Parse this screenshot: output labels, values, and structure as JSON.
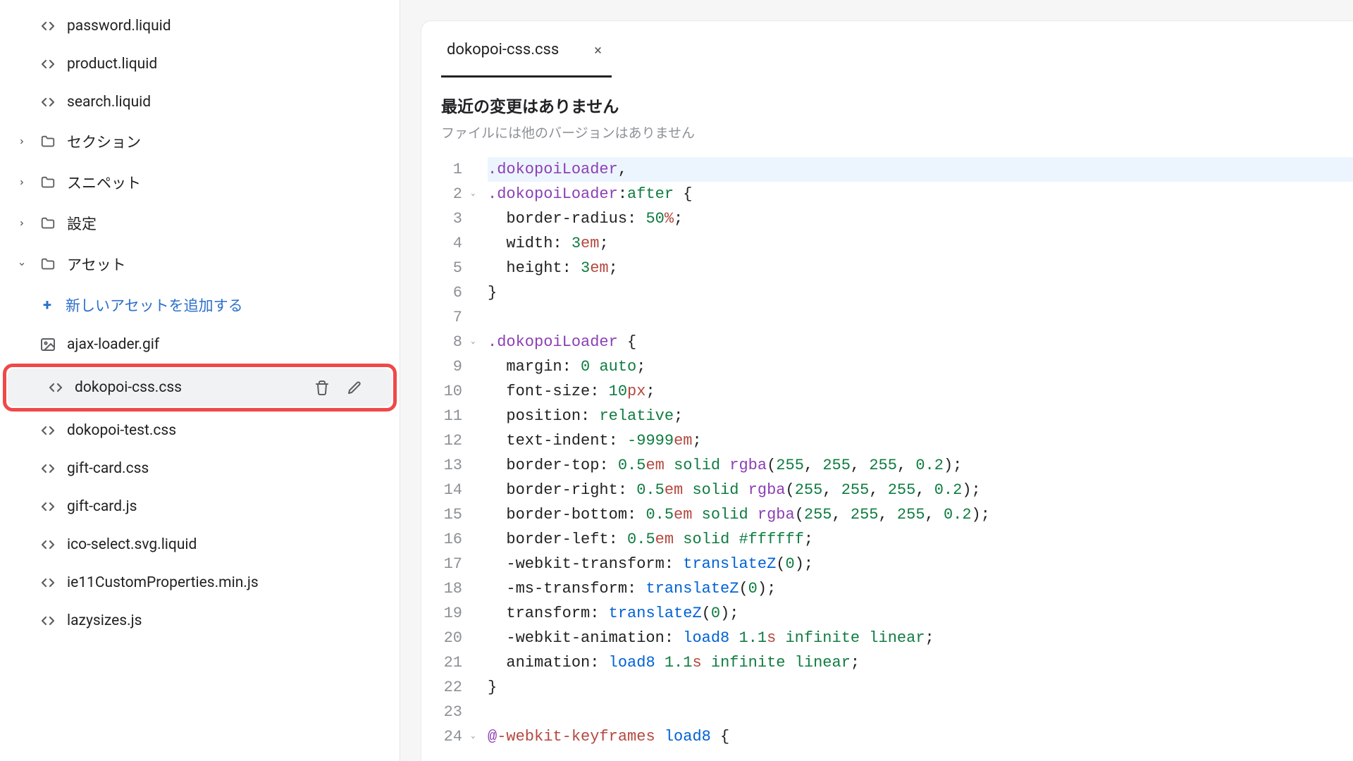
{
  "sidebar": {
    "files_top": [
      {
        "name": "password.liquid",
        "icon": "code"
      },
      {
        "name": "product.liquid",
        "icon": "code"
      },
      {
        "name": "search.liquid",
        "icon": "code"
      }
    ],
    "folders": [
      {
        "name": "セクション",
        "expanded": false
      },
      {
        "name": "スニペット",
        "expanded": false
      },
      {
        "name": "設定",
        "expanded": false
      },
      {
        "name": "アセット",
        "expanded": true
      }
    ],
    "add_asset_label": "新しいアセットを追加する",
    "assets": [
      {
        "name": "ajax-loader.gif",
        "icon": "image"
      },
      {
        "name": "dokopoi-css.css",
        "icon": "code",
        "selected": true,
        "highlight": true
      },
      {
        "name": "dokopoi-test.css",
        "icon": "code"
      },
      {
        "name": "gift-card.css",
        "icon": "code"
      },
      {
        "name": "gift-card.js",
        "icon": "code"
      },
      {
        "name": "ico-select.svg.liquid",
        "icon": "code"
      },
      {
        "name": "ie11CustomProperties.min.js",
        "icon": "code"
      },
      {
        "name": "lazysizes.js",
        "icon": "code"
      }
    ]
  },
  "editor": {
    "tab_name": "dokopoi-css.css",
    "info_title": "最近の変更はありません",
    "info_subtitle": "ファイルには他のバージョンはありません",
    "fold_lines": [
      2,
      8,
      24
    ],
    "current_line": 1,
    "code_lines": [
      [
        {
          "t": "sel",
          "v": ".dokopoiLoader"
        },
        {
          "t": "punct",
          "v": ","
        }
      ],
      [
        {
          "t": "sel",
          "v": ".dokopoiLoader"
        },
        {
          "t": "punct",
          "v": ":"
        },
        {
          "t": "pseudo",
          "v": "after"
        },
        {
          "t": "punct",
          "v": " {"
        }
      ],
      [
        {
          "t": "prop",
          "v": "  border-radius: "
        },
        {
          "t": "num",
          "v": "50"
        },
        {
          "t": "unit",
          "v": "%"
        },
        {
          "t": "punct",
          "v": ";"
        }
      ],
      [
        {
          "t": "prop",
          "v": "  width: "
        },
        {
          "t": "num",
          "v": "3"
        },
        {
          "t": "unit",
          "v": "em"
        },
        {
          "t": "punct",
          "v": ";"
        }
      ],
      [
        {
          "t": "prop",
          "v": "  height: "
        },
        {
          "t": "num",
          "v": "3"
        },
        {
          "t": "unit",
          "v": "em"
        },
        {
          "t": "punct",
          "v": ";"
        }
      ],
      [
        {
          "t": "punct",
          "v": "}"
        }
      ],
      [],
      [
        {
          "t": "sel",
          "v": ".dokopoiLoader"
        },
        {
          "t": "punct",
          "v": " {"
        }
      ],
      [
        {
          "t": "prop",
          "v": "  margin: "
        },
        {
          "t": "num",
          "v": "0 "
        },
        {
          "t": "pseudo",
          "v": "auto"
        },
        {
          "t": "punct",
          "v": ";"
        }
      ],
      [
        {
          "t": "prop",
          "v": "  font-size: "
        },
        {
          "t": "num",
          "v": "10"
        },
        {
          "t": "unit",
          "v": "px"
        },
        {
          "t": "punct",
          "v": ";"
        }
      ],
      [
        {
          "t": "prop",
          "v": "  position: "
        },
        {
          "t": "pseudo",
          "v": "relative"
        },
        {
          "t": "punct",
          "v": ";"
        }
      ],
      [
        {
          "t": "prop",
          "v": "  text-indent: "
        },
        {
          "t": "num",
          "v": "-9999"
        },
        {
          "t": "unit",
          "v": "em"
        },
        {
          "t": "punct",
          "v": ";"
        }
      ],
      [
        {
          "t": "prop",
          "v": "  border-top: "
        },
        {
          "t": "num",
          "v": "0.5"
        },
        {
          "t": "unit",
          "v": "em "
        },
        {
          "t": "pseudo",
          "v": "solid "
        },
        {
          "t": "func",
          "v": "rgba"
        },
        {
          "t": "punct",
          "v": "("
        },
        {
          "t": "num",
          "v": "255"
        },
        {
          "t": "punct",
          "v": ", "
        },
        {
          "t": "num",
          "v": "255"
        },
        {
          "t": "punct",
          "v": ", "
        },
        {
          "t": "num",
          "v": "255"
        },
        {
          "t": "punct",
          "v": ", "
        },
        {
          "t": "num",
          "v": "0.2"
        },
        {
          "t": "punct",
          "v": ");"
        }
      ],
      [
        {
          "t": "prop",
          "v": "  border-right: "
        },
        {
          "t": "num",
          "v": "0.5"
        },
        {
          "t": "unit",
          "v": "em "
        },
        {
          "t": "pseudo",
          "v": "solid "
        },
        {
          "t": "func",
          "v": "rgba"
        },
        {
          "t": "punct",
          "v": "("
        },
        {
          "t": "num",
          "v": "255"
        },
        {
          "t": "punct",
          "v": ", "
        },
        {
          "t": "num",
          "v": "255"
        },
        {
          "t": "punct",
          "v": ", "
        },
        {
          "t": "num",
          "v": "255"
        },
        {
          "t": "punct",
          "v": ", "
        },
        {
          "t": "num",
          "v": "0.2"
        },
        {
          "t": "punct",
          "v": ");"
        }
      ],
      [
        {
          "t": "prop",
          "v": "  border-bottom: "
        },
        {
          "t": "num",
          "v": "0.5"
        },
        {
          "t": "unit",
          "v": "em "
        },
        {
          "t": "pseudo",
          "v": "solid "
        },
        {
          "t": "func",
          "v": "rgba"
        },
        {
          "t": "punct",
          "v": "("
        },
        {
          "t": "num",
          "v": "255"
        },
        {
          "t": "punct",
          "v": ", "
        },
        {
          "t": "num",
          "v": "255"
        },
        {
          "t": "punct",
          "v": ", "
        },
        {
          "t": "num",
          "v": "255"
        },
        {
          "t": "punct",
          "v": ", "
        },
        {
          "t": "num",
          "v": "0.2"
        },
        {
          "t": "punct",
          "v": ");"
        }
      ],
      [
        {
          "t": "prop",
          "v": "  border-left: "
        },
        {
          "t": "num",
          "v": "0.5"
        },
        {
          "t": "unit",
          "v": "em "
        },
        {
          "t": "pseudo",
          "v": "solid "
        },
        {
          "t": "hex",
          "v": "#ffffff"
        },
        {
          "t": "punct",
          "v": ";"
        }
      ],
      [
        {
          "t": "prop",
          "v": "  -webkit-transform: "
        },
        {
          "t": "ident",
          "v": "translateZ"
        },
        {
          "t": "punct",
          "v": "("
        },
        {
          "t": "num",
          "v": "0"
        },
        {
          "t": "punct",
          "v": ");"
        }
      ],
      [
        {
          "t": "prop",
          "v": "  -ms-transform: "
        },
        {
          "t": "ident",
          "v": "translateZ"
        },
        {
          "t": "punct",
          "v": "("
        },
        {
          "t": "num",
          "v": "0"
        },
        {
          "t": "punct",
          "v": ");"
        }
      ],
      [
        {
          "t": "prop",
          "v": "  transform: "
        },
        {
          "t": "ident",
          "v": "translateZ"
        },
        {
          "t": "punct",
          "v": "("
        },
        {
          "t": "num",
          "v": "0"
        },
        {
          "t": "punct",
          "v": ");"
        }
      ],
      [
        {
          "t": "prop",
          "v": "  -webkit-animation: "
        },
        {
          "t": "ident",
          "v": "load8 "
        },
        {
          "t": "num",
          "v": "1.1"
        },
        {
          "t": "unit",
          "v": "s "
        },
        {
          "t": "pseudo",
          "v": "infinite linear"
        },
        {
          "t": "punct",
          "v": ";"
        }
      ],
      [
        {
          "t": "prop",
          "v": "  animation: "
        },
        {
          "t": "ident",
          "v": "load8 "
        },
        {
          "t": "num",
          "v": "1.1"
        },
        {
          "t": "unit",
          "v": "s "
        },
        {
          "t": "pseudo",
          "v": "infinite linear"
        },
        {
          "t": "punct",
          "v": ";"
        }
      ],
      [
        {
          "t": "punct",
          "v": "}"
        }
      ],
      [],
      [
        {
          "t": "at",
          "v": "@"
        },
        {
          "t": "atname",
          "v": "-webkit-keyframes "
        },
        {
          "t": "atid",
          "v": "load8"
        },
        {
          "t": "punct",
          "v": " {"
        }
      ]
    ]
  }
}
